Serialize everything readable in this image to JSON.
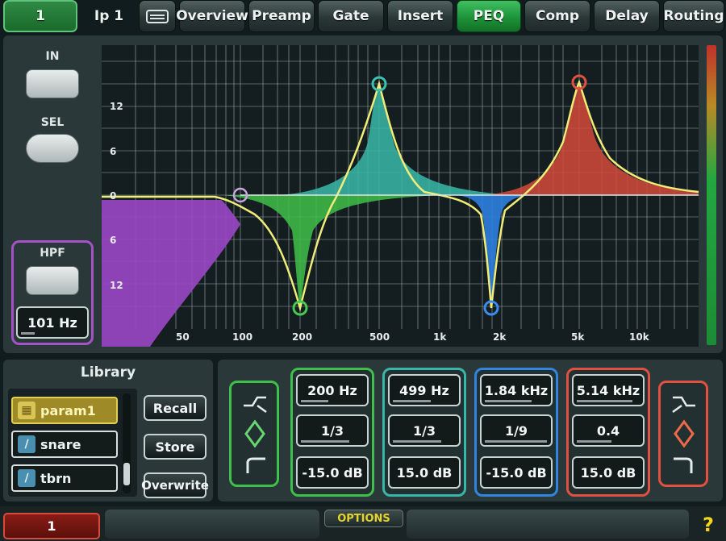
{
  "tabs": {
    "channel": "1",
    "name": "Ip 1",
    "items": [
      "Overview",
      "Preamp",
      "Gate",
      "Insert",
      "PEQ",
      "Comp",
      "Delay",
      "Routing"
    ],
    "active": "PEQ"
  },
  "left": {
    "in_label": "IN",
    "sel_label": "SEL",
    "hpf_label": "HPF",
    "hpf_value": "101 Hz"
  },
  "graph": {
    "y_ticks": [
      "12",
      "6",
      "0",
      "6",
      "12"
    ],
    "x_ticks": [
      "50",
      "100",
      "200",
      "500",
      "1k",
      "2k",
      "5k",
      "10k"
    ]
  },
  "library": {
    "title": "Library",
    "items": [
      "param1",
      "snare",
      "tbrn"
    ],
    "selected": "param1",
    "recall": "Recall",
    "store": "Store",
    "overwrite": "Overwrite"
  },
  "bands": [
    {
      "freq": "200 Hz",
      "width": "1/3",
      "gain": "-15.0 dB",
      "color": "#3fc04a"
    },
    {
      "freq": "499 Hz",
      "width": "1/3",
      "gain": "15.0 dB",
      "color": "#37b7a8"
    },
    {
      "freq": "1.84 kHz",
      "width": "1/9",
      "gain": "-15.0 dB",
      "color": "#2f86e0"
    },
    {
      "freq": "5.14 kHz",
      "width": "0.4",
      "gain": "15.0 dB",
      "color": "#e0523f"
    }
  ],
  "bottom": {
    "channel": "1",
    "options": "OPTIONS",
    "help": "?"
  },
  "colors": {
    "hpf": "#a552c8",
    "curve": "#e8e36a",
    "accent_green": "#2fa84a",
    "meter_green": "#22a840",
    "meter_red": "#c0322a"
  },
  "icons": {
    "left_shelf": "low-shelf-icon",
    "left_bell": "bell-icon",
    "left_hpf": "high-pass-icon",
    "right_shelf": "high-shelf-icon",
    "right_bell": "bell-icon",
    "right_lpf": "low-pass-icon",
    "screen": "keyboard-icon"
  }
}
